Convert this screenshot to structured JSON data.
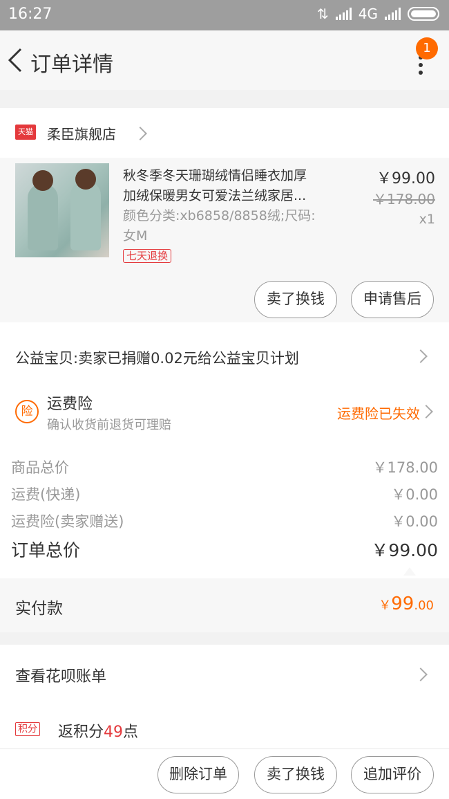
{
  "status_bar": {
    "time": "16:27",
    "network": "4G"
  },
  "header": {
    "title": "订单详情",
    "badge_count": "1"
  },
  "shop": {
    "logo_text": "天猫",
    "name": "柔臣旗舰店"
  },
  "item": {
    "title_line1": "秋冬季冬天珊瑚绒情侣睡衣加厚",
    "title_line2": "加绒保暖男女可爱法兰绒家居...",
    "sku_line1": "颜色分类:xb6858/8858绒;尺码:",
    "sku_line2": "女M",
    "tag": "七天退换",
    "price": "￥99.00",
    "original_price": "￥178.00",
    "quantity": "x1",
    "sell_button": "卖了换钱",
    "after_sale_button": "申请售后"
  },
  "charity": {
    "text": "公益宝贝:卖家已捐赠0.02元给公益宝贝计划"
  },
  "insurance": {
    "icon_text": "险",
    "title": "运费险",
    "subtitle": "确认收货前退货可理赔",
    "status": "运费险已失效"
  },
  "summary": {
    "rows": [
      {
        "label": "商品总价",
        "value": "￥178.00"
      },
      {
        "label": "运费(快递)",
        "value": "￥0.00"
      },
      {
        "label": "运费险(卖家赠送)",
        "value": "￥0.00"
      }
    ],
    "total_label": "订单总价",
    "total_value": "￥99.00"
  },
  "paid": {
    "label": "实付款",
    "currency": "￥",
    "amount_int": "99",
    "amount_dec": ".00"
  },
  "huabei": {
    "text": "查看花呗账单"
  },
  "points": {
    "tag": "积分",
    "prefix": "返积分",
    "count": "49",
    "suffix": "点"
  },
  "footer": {
    "delete_button": "删除订单",
    "sell_button": "卖了换钱",
    "review_button": "追加评价"
  },
  "colors": {
    "accent": "#ff6a00",
    "tmall_red": "#e4393c",
    "status_bar": "#9e9e9e"
  }
}
